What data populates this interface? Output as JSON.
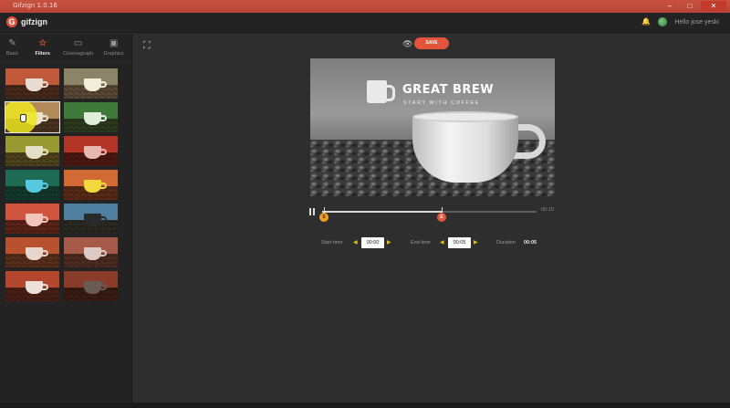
{
  "window": {
    "title": "Gifzign 1.0.16"
  },
  "app": {
    "logo_text": "gifzign",
    "greeting": "Hello jose yeski",
    "accent": "#e2543c"
  },
  "sidebar": {
    "tabs": [
      {
        "label": "Basic",
        "icon": "pencil-icon"
      },
      {
        "label": "Filters",
        "icon": "star-icon",
        "active": true
      },
      {
        "label": "Cinemagraph",
        "icon": "film-icon"
      },
      {
        "label": "Graphics",
        "icon": "image-icon"
      }
    ],
    "filters": [
      {
        "bg": "#c0583a",
        "beans": "#4a2a1a",
        "cup": "#e8dcd2"
      },
      {
        "bg": "#8c8468",
        "beans": "#5a4a36",
        "cup": "#f2ecd8"
      },
      {
        "bg": "#b28a5a",
        "beans": "#4b3322",
        "cup": "#ece2d4"
      },
      {
        "bg": "#3f7a3a",
        "beans": "#2e3a1e",
        "cup": "#e2eedc"
      },
      {
        "bg": "#9a9a32",
        "beans": "#52431c",
        "cup": "#e4e0c8"
      },
      {
        "bg": "#b23528",
        "beans": "#4e1812",
        "cup": "#e8b8b0"
      },
      {
        "bg": "#1f6a52",
        "beans": "#143a2e",
        "cup": "#56c8e0"
      },
      {
        "bg": "#d26a36",
        "beans": "#5a2c16",
        "cup": "#f2d83a"
      },
      {
        "bg": "#d0553e",
        "beans": "#5c2418",
        "cup": "#f2c4bc"
      },
      {
        "bg": "#4f7fa0",
        "beans": "#2a2a22",
        "cup": "#2a2a2a"
      },
      {
        "bg": "#b8522e",
        "beans": "#5a2e1a",
        "cup": "#e6d6cc"
      },
      {
        "bg": "#a85a4a",
        "beans": "#4e2c22",
        "cup": "#dccac4"
      },
      {
        "bg": "#b3472e",
        "beans": "#4a2016",
        "cup": "#ece0d8"
      },
      {
        "bg": "#8a3c2a",
        "beans": "#3a1c12",
        "cup": "#6a5a54"
      }
    ],
    "selected_index": 2
  },
  "toolbar": {
    "crop_icon": "crop-icon",
    "preview_icon": "eye-icon",
    "save_label": "SAVE"
  },
  "preview": {
    "headline": "GREAT BREW",
    "subline": "START WITH COFFEE"
  },
  "timeline": {
    "total_time": "00:10",
    "start_marker": "S",
    "end_marker": "E",
    "played_fraction": 0.56
  },
  "trim": {
    "start_label": "Start time",
    "start_value": "00:00",
    "end_label": "End time",
    "end_value": "00:05",
    "duration_label": "Duration",
    "duration_value": "00:05"
  }
}
